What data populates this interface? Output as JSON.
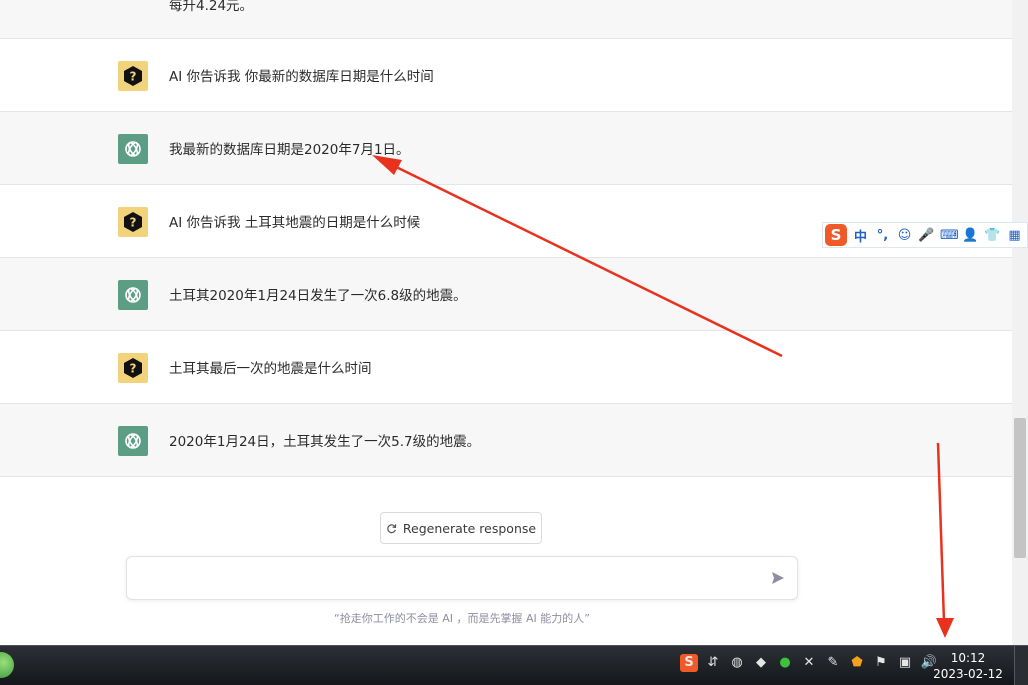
{
  "conversation": {
    "partial_prev": "每升4.24元。",
    "messages": [
      {
        "role": "user",
        "text": "AI 你告诉我 你最新的数据库日期是什么时间"
      },
      {
        "role": "bot",
        "text": "我最新的数据库日期是2020年7月1日。"
      },
      {
        "role": "user",
        "text": "AI 你告诉我 土耳其地震的日期是什么时候"
      },
      {
        "role": "bot",
        "text": "土耳其2020年1月24日发生了一次6.8级的地震。"
      },
      {
        "role": "user",
        "text": "土耳其最后一次的地震是什么时间"
      },
      {
        "role": "bot",
        "text": "2020年1月24日，土耳其发生了一次5.7级的地震。"
      }
    ]
  },
  "controls": {
    "regenerate_label": "Regenerate response",
    "input_value": "",
    "footer_text": "“抢走你工作的不会是 AI ，而是先掌握 AI 能力的人”"
  },
  "ime_toolbar": {
    "logo": "S",
    "mode": "中",
    "punct": "°,",
    "icons": [
      "emoji-icon",
      "mic-icon",
      "keyboard-icon",
      "user-icon",
      "tshirt-icon",
      "grid-icon"
    ]
  },
  "taskbar": {
    "time": "10:12",
    "date": "2023-02-12"
  },
  "colors": {
    "user_avatar": "#f1d37c",
    "bot_avatar": "#5c9d86",
    "annotation_arrow": "#e8321e"
  }
}
